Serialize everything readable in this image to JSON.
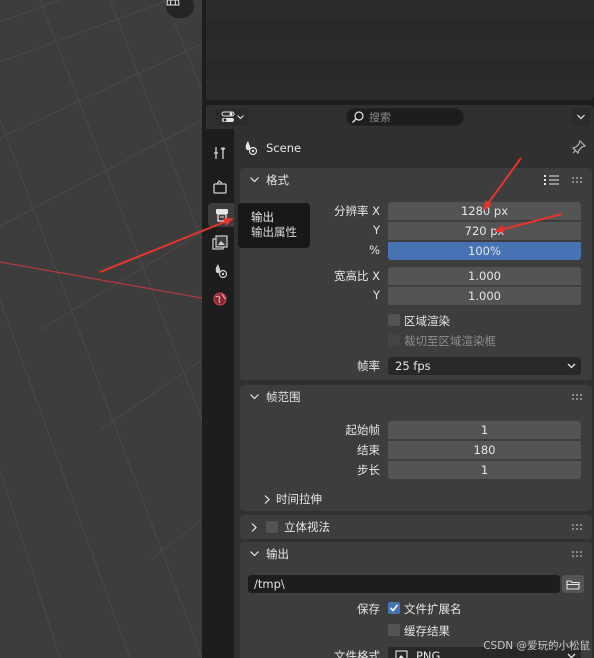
{
  "header": {
    "search_placeholder": "搜索"
  },
  "context": {
    "scene_label": "Scene"
  },
  "tooltip": {
    "title": "输出",
    "subtitle": "输出属性"
  },
  "tabs": [
    {
      "name": "tool-tab",
      "icon": "tool-icon"
    },
    {
      "name": "render-tab",
      "icon": "render-camera-icon"
    },
    {
      "name": "output-tab",
      "icon": "printer-icon",
      "active": true
    },
    {
      "name": "view-layer-tab",
      "icon": "image-stack-icon"
    },
    {
      "name": "scene-tab",
      "icon": "scene-icon"
    },
    {
      "name": "world-tab",
      "icon": "world-icon"
    }
  ],
  "format_panel": {
    "title": "格式",
    "resolution_x_label": "分辨率 X",
    "resolution_x": "1280 px",
    "resolution_y_label": "Y",
    "resolution_y": "720 px",
    "percent_label": "%",
    "percent": "100%",
    "percent_value": 1.0,
    "aspect_x_label": "宽高比 X",
    "aspect_x": "1.000",
    "aspect_y_label": "Y",
    "aspect_y": "1.000",
    "region_render_label": "区域渲染",
    "crop_label": "裁切至区域渲染框",
    "fps_label": "帧率",
    "fps": "25 fps"
  },
  "frame_range_panel": {
    "title": "帧范围",
    "start_label": "起始帧",
    "start": "1",
    "end_label": "结束",
    "end": "180",
    "step_label": "步长",
    "step": "1",
    "time_stretch_label": "时间拉伸"
  },
  "stereo_panel": {
    "title": "立体视法"
  },
  "output_panel": {
    "title": "输出",
    "path": "/tmp\\",
    "save_label": "保存",
    "file_ext_label": "文件扩展名",
    "cache_label": "缓存结果",
    "file_format_label": "文件格式",
    "file_format": "PNG"
  },
  "watermark": "CSDN @爱玩的小松鼠",
  "colors": {
    "accent": "#4772b3",
    "annotation_arrow": "#e8332a"
  }
}
